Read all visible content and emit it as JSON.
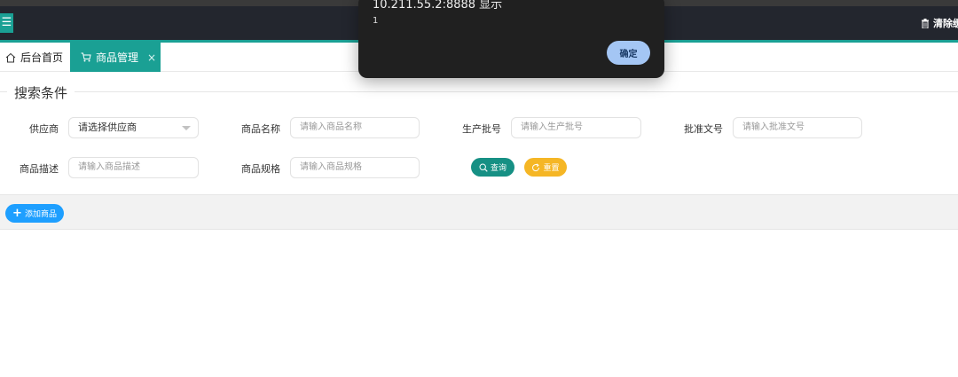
{
  "header": {
    "menu_icon": "hamburger-icon",
    "clear_cache_label": "清除缓",
    "clear_cache_icon": "trash-icon",
    "background": "#23262e",
    "accent": "#1aa094"
  },
  "tabs": [
    {
      "label": "后台首页",
      "icon": "home-icon"
    },
    {
      "label": "商品管理",
      "icon": "cart-icon",
      "close": "×",
      "active": true
    }
  ],
  "search": {
    "legend": "搜索条件",
    "fields": {
      "supplier": {
        "label": "供应商",
        "value": "请选择供应商"
      },
      "name": {
        "label": "商品名称",
        "placeholder": "请输入商品名称"
      },
      "batch": {
        "label": "生产批号",
        "placeholder": "请输入生产批号"
      },
      "approval": {
        "label": "批准文号",
        "placeholder": "请输入批准文号"
      },
      "desc": {
        "label": "商品描述",
        "placeholder": "请输入商品描述"
      },
      "spec": {
        "label": "商品规格",
        "placeholder": "请输入商品规格"
      }
    },
    "query_label": "查询",
    "reset_label": "重置"
  },
  "toolbar": {
    "add_label": "添加商品"
  },
  "dialog": {
    "title": "10.211.55.2:8888 显示",
    "message": "1",
    "ok_label": "确定"
  }
}
